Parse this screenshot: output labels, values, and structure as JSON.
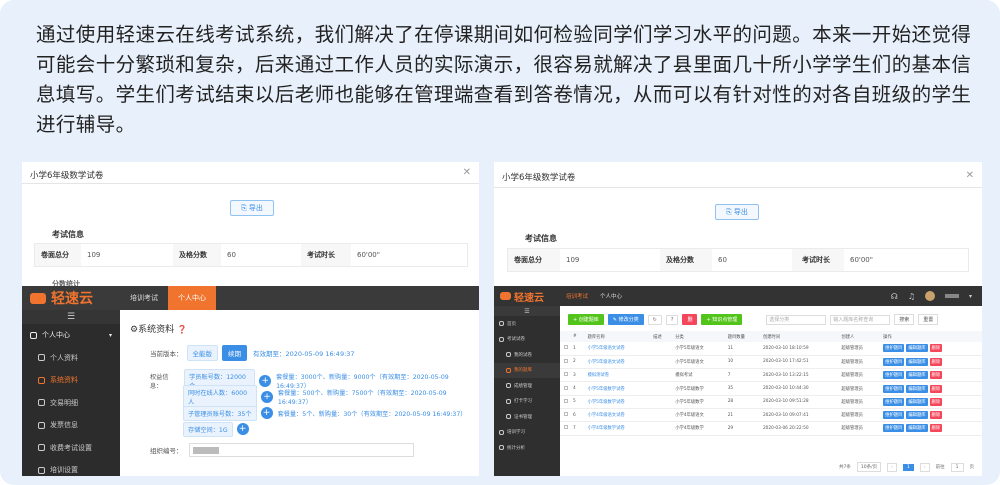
{
  "intro": "通过使用轻速云在线考试系统，我们解决了在停课期间如何检验同学们学习水平的问题。本来一开始还觉得可能会十分繁琐和复杂，后来通过工作人员的实际演示，很容易就解决了县里面几十所小学学生们的基本信息填写。学生们考试结束以后老师也能够在管理端查看到答卷情况，从而可以有针对性的对各自班级的学生进行辅导。",
  "left": {
    "dialog_title": "小学6年级数学试卷",
    "export": "导出",
    "exam_info_title": "考试信息",
    "info": [
      {
        "k": "卷面总分",
        "v": "109"
      },
      {
        "k": "及格分数",
        "v": "60"
      },
      {
        "k": "考试时长",
        "v": "60'00\""
      }
    ],
    "partial_label": "分数统计",
    "brand": "轻速云",
    "top_tabs": [
      "培训考试",
      "个人中心"
    ],
    "side_menu": [
      {
        "label": "个人中心",
        "icon": "person-icon",
        "active": false,
        "header": true
      },
      {
        "label": "个人资料",
        "icon": "profile-icon",
        "active": false
      },
      {
        "label": "系统资料",
        "icon": "system-icon",
        "active": true
      },
      {
        "label": "交易明细",
        "icon": "trade-icon",
        "active": false
      },
      {
        "label": "发票信息",
        "icon": "invoice-icon",
        "active": false
      },
      {
        "label": "收费考试设置",
        "icon": "fee-icon",
        "active": false
      },
      {
        "label": "培训设置",
        "icon": "settings-icon",
        "active": false
      }
    ],
    "section_title": "系统资料",
    "version_label": "当前版本：",
    "version_opts": [
      "全能版",
      "续期"
    ],
    "version_valid": "有效期至：2020-05-09 16:49:37",
    "rights_label": "权益信息：",
    "rights": [
      {
        "pill": "学员账号数：12000个",
        "text": "套餐量：3000个、新购量：9000个（有效期至：2020-05-09 16:49:37）"
      },
      {
        "pill": "同时在线人数：6000人",
        "text": "套餐量：500个、新购量：7500个（有效期至：2020-05-09 16:49:37）"
      },
      {
        "pill": "子管理员账号数：35个",
        "text": "套餐量：5个、新购量：30个（有效期至：2020-05-09 16:49:37）"
      },
      {
        "pill": "存储空间：1G",
        "text": ""
      }
    ],
    "org_label": "组织编号："
  },
  "right": {
    "dialog_title": "小学6年级数学试卷",
    "export": "导出",
    "exam_info_title": "考试信息",
    "info": [
      {
        "k": "卷面总分",
        "v": "109"
      },
      {
        "k": "及格分数",
        "v": "60"
      },
      {
        "k": "考试时长",
        "v": "60'00\""
      }
    ],
    "brand": "轻速云",
    "top_tabs": [
      "培训考试",
      "个人中心"
    ],
    "side_menu": [
      {
        "label": "首页",
        "icon": "home-icon"
      },
      {
        "label": "考试试卷",
        "icon": "paper-icon"
      },
      {
        "label": "我的试卷",
        "icon": "mypaper-icon"
      },
      {
        "label": "我的题库",
        "icon": "bank-icon",
        "active": true
      },
      {
        "label": "成绩管理",
        "icon": "score-icon"
      },
      {
        "label": "打卡学习",
        "icon": "clock-icon"
      },
      {
        "label": "证书管理",
        "icon": "cert-icon"
      },
      {
        "label": "培训学习",
        "icon": "study-icon"
      },
      {
        "label": "统计分析",
        "icon": "chart-icon"
      }
    ],
    "toolbar": {
      "create": "创建题库",
      "edit": "修改分类",
      "del": "删",
      "knowledge": "知识点管理",
      "search_placeholder": "选择分类",
      "name_placeholder": "输入题库名称查询",
      "search_btn": "搜索",
      "reset_btn": "重置"
    },
    "columns": [
      "#",
      "题库名称",
      "描述",
      "分类",
      "题目数量",
      "创建时间",
      "创建人",
      "操作"
    ],
    "rows": [
      [
        "1",
        "小学5年级语文试卷",
        "",
        "小学5年级语文",
        "11",
        "2020-03-10 18:10:59",
        "超级管理员"
      ],
      [
        "2",
        "小学5年级语文试卷",
        "",
        "小学5年级语文",
        "10",
        "2020-03-10 17:42:51",
        "超级管理员"
      ],
      [
        "3",
        "模拟测试卷",
        "",
        "模拟考试",
        "7",
        "2020-03-10 13:22:15",
        "超级管理员"
      ],
      [
        "4",
        "小学5年级数学试卷",
        "",
        "小学5年级数学",
        "35",
        "2020-03-10 10:44:30",
        "超级管理员"
      ],
      [
        "5",
        "小学5年级数学试卷",
        "",
        "小学5年级数学",
        "28",
        "2020-03-10 09:51:28",
        "超级管理员"
      ],
      [
        "6",
        "小学4年级语文试卷",
        "",
        "小学4年级语文",
        "21",
        "2020-03-10 09:07:41",
        "超级管理员"
      ],
      [
        "7",
        "小学4年级数学试卷",
        "",
        "小学4年级数学",
        "29",
        "2020-03-06 20:22:50",
        "超级管理员"
      ]
    ],
    "row_actions": [
      "维护题目",
      "编辑题库",
      "删除"
    ],
    "pagination": {
      "total": "共7条",
      "per_page": "10条/页",
      "page": "1",
      "goto": "前往",
      "page_suffix": "页"
    }
  },
  "colors": {
    "accent": "#f0742e",
    "blue": "#3a8ee6",
    "green": "#52c41a",
    "red": "#f5475b",
    "bg": "#e8f0fb"
  }
}
